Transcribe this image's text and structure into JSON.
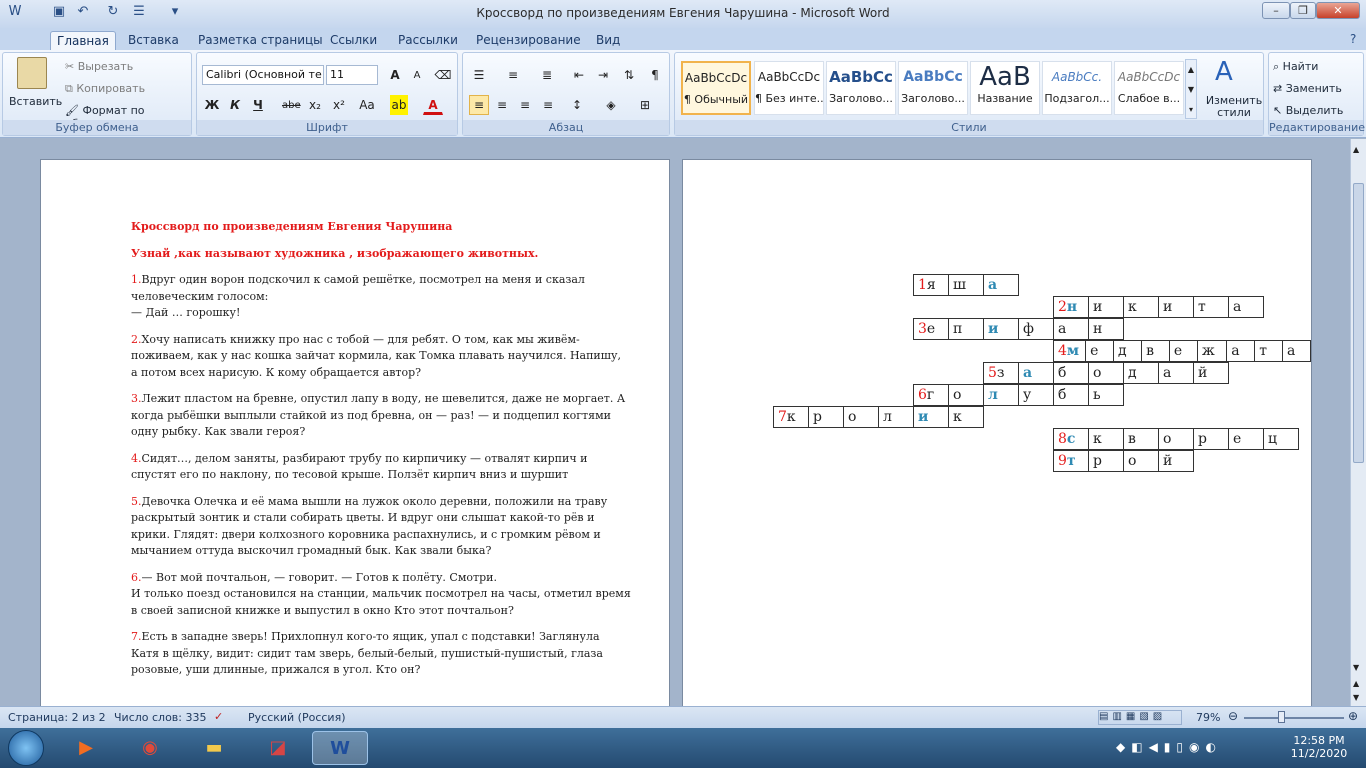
{
  "window": {
    "title": "Кроссворд  по произведениям Евгения Чарушина - Microsoft Word",
    "min": "–",
    "max": "❐",
    "close": "✕"
  },
  "qat": [
    "save-icon",
    "undo-icon",
    "redo-icon",
    "bullets-icon"
  ],
  "tabs": [
    "Главная",
    "Вставка",
    "Разметка страницы",
    "Ссылки",
    "Рассылки",
    "Рецензирование",
    "Вид"
  ],
  "clipboard": {
    "paste": "Вставить",
    "cut": "Вырезать",
    "copy": "Копировать",
    "format": "Формат по образцу",
    "label": "Буфер обмена"
  },
  "font": {
    "name": "Calibri (Основной те",
    "size": "11",
    "label": "Шрифт",
    "bold": "Ж",
    "italic": "К",
    "underline": "Ч",
    "strike": "abe",
    "sub": "x₂",
    "sup": "x²",
    "case": "Aa",
    "grow": "A",
    "shrink": "A"
  },
  "paragraph": {
    "label": "Абзац",
    "pilcrow": "¶"
  },
  "styles": {
    "label": "Стили",
    "items": [
      {
        "preview": "AaBbCcDc",
        "name": "¶ Обычный"
      },
      {
        "preview": "AaBbCcDc",
        "name": "¶ Без инте..."
      },
      {
        "preview": "AaBbCc",
        "name": "Заголово..."
      },
      {
        "preview": "AaBbCc",
        "name": "Заголово..."
      },
      {
        "preview": "AaB",
        "name": "Название"
      },
      {
        "preview": "AaBbCc.",
        "name": "Подзагол..."
      },
      {
        "preview": "AaBbCcDc",
        "name": "Слабое в..."
      }
    ],
    "change": "Изменить стили"
  },
  "editing": {
    "find": "Найти",
    "replace": "Заменить",
    "select": "Выделить",
    "label": "Редактирование"
  },
  "doc": {
    "title": "Кроссворд  по произведениям Евгения Чарушина",
    "subtitle": "Узнай ,как называют художника , изображающего животных.",
    "q": [
      {
        "n": "1.",
        "t": "Вдруг один ворон подскочил к самой решётке, посмотрел на меня и сказал человеческим голосом:",
        "t2": "— Дай … горошку!"
      },
      {
        "n": "2.",
        "t": "Хочу написать книжку про нас с тобой — для ребят. О том, как мы живём-поживаем, как у нас кошка зайчат кормила, как Томка плавать научился. Напишу, а потом всех нарисую. К кому обращается автор?"
      },
      {
        "n": "3.",
        "t": "Лежит пластом на бревне, опустил лапу в воду, не шевелится, даже не моргает. А когда рыбёшки выплыли стайкой из под бревна, он — раз! — и подцепил когтями одну рыбку. Как звали героя?"
      },
      {
        "n": "4.",
        "t": "Сидят…, делом заняты, разбирают трубу по кирпичику — отвалят кирпич и спустят его по наклону, по тесовой крыше. Ползёт кирпич вниз и шуршит"
      },
      {
        "n": "5.",
        "t": "Девочка Олечка и её мама вышли на лужок около деревни, положили на траву раскрытый зонтик и стали собирать цветы. И вдруг они слышат какой-то рёв и крики. Глядят: двери колхозного коровника распахнулись, и с громким рёвом и мычанием оттуда выскочил громадный бык. Как звали быка?"
      },
      {
        "n": "6.",
        "t": "— Вот мой почтальон, — говорит. — Готов к полёту. Смотри.",
        "t2": "И только поезд остановился на станции, мальчик посмотрел на часы, отметил время в своей записной книжке и выпустил в окно Кто этот почтальон?"
      },
      {
        "n": "7.",
        "t": "Есть в западне зверь! Прихлопнул кого-то ящик, упал с подставки! Заглянула Катя в щёлку, видит: сидит там зверь, белый-белый, пушистый-пушистый, глаза розовые,  уши длинные, прижался в угол. Кто он?"
      }
    ]
  },
  "crossword": {
    "rows": [
      {
        "num": "1",
        "letters": [
          "я",
          "ш",
          "а"
        ]
      },
      {
        "num": "2",
        "letters": [
          "н",
          "и",
          "к",
          "и",
          "т",
          "а"
        ]
      },
      {
        "num": "3",
        "letters": [
          "е",
          "п",
          "и",
          "ф",
          "а",
          "н"
        ]
      },
      {
        "num": "4",
        "letters": [
          "м",
          "е",
          "д",
          "в",
          "е",
          "ж",
          "а",
          "т",
          "а"
        ]
      },
      {
        "num": "5",
        "letters": [
          "з",
          "а",
          "б",
          "о",
          "д",
          "а",
          "й"
        ]
      },
      {
        "num": "6",
        "letters": [
          "г",
          "о",
          "л",
          "у",
          "б",
          "ь"
        ]
      },
      {
        "num": "7",
        "letters": [
          "к",
          "р",
          "о",
          "л",
          "и",
          "к"
        ]
      },
      {
        "num": "8",
        "letters": [
          "с",
          "к",
          "в",
          "о",
          "р",
          "е",
          "ц"
        ]
      },
      {
        "num": "9",
        "letters": [
          "т",
          "р",
          "о",
          "й"
        ]
      }
    ]
  },
  "status": {
    "page": "Страница: 2 из 2",
    "words": "Число слов: 335",
    "lang": "Русский (Россия)",
    "zoom": "79%"
  },
  "tray": {
    "time": "12:58 PM",
    "date": "11/2/2020"
  }
}
